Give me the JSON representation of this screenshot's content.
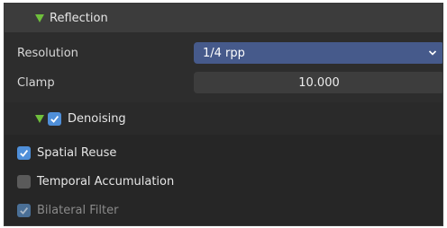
{
  "panel": {
    "title": "Reflection"
  },
  "properties": {
    "resolution_label": "Resolution",
    "resolution_value": "1/4 rpp",
    "clamp_label": "Clamp",
    "clamp_value": "10.000"
  },
  "denoising": {
    "title": "Denoising",
    "checked": true,
    "options": [
      {
        "label": "Spatial Reuse",
        "checked": true,
        "enabled": true
      },
      {
        "label": "Temporal Accumulation",
        "checked": false,
        "enabled": true
      },
      {
        "label": "Bilateral Filter",
        "checked": true,
        "enabled": false
      }
    ]
  },
  "colors": {
    "accent": "#4f8fd9",
    "dropdown_bg": "#465a8b",
    "expand_triangle": "#6fbf3c"
  }
}
